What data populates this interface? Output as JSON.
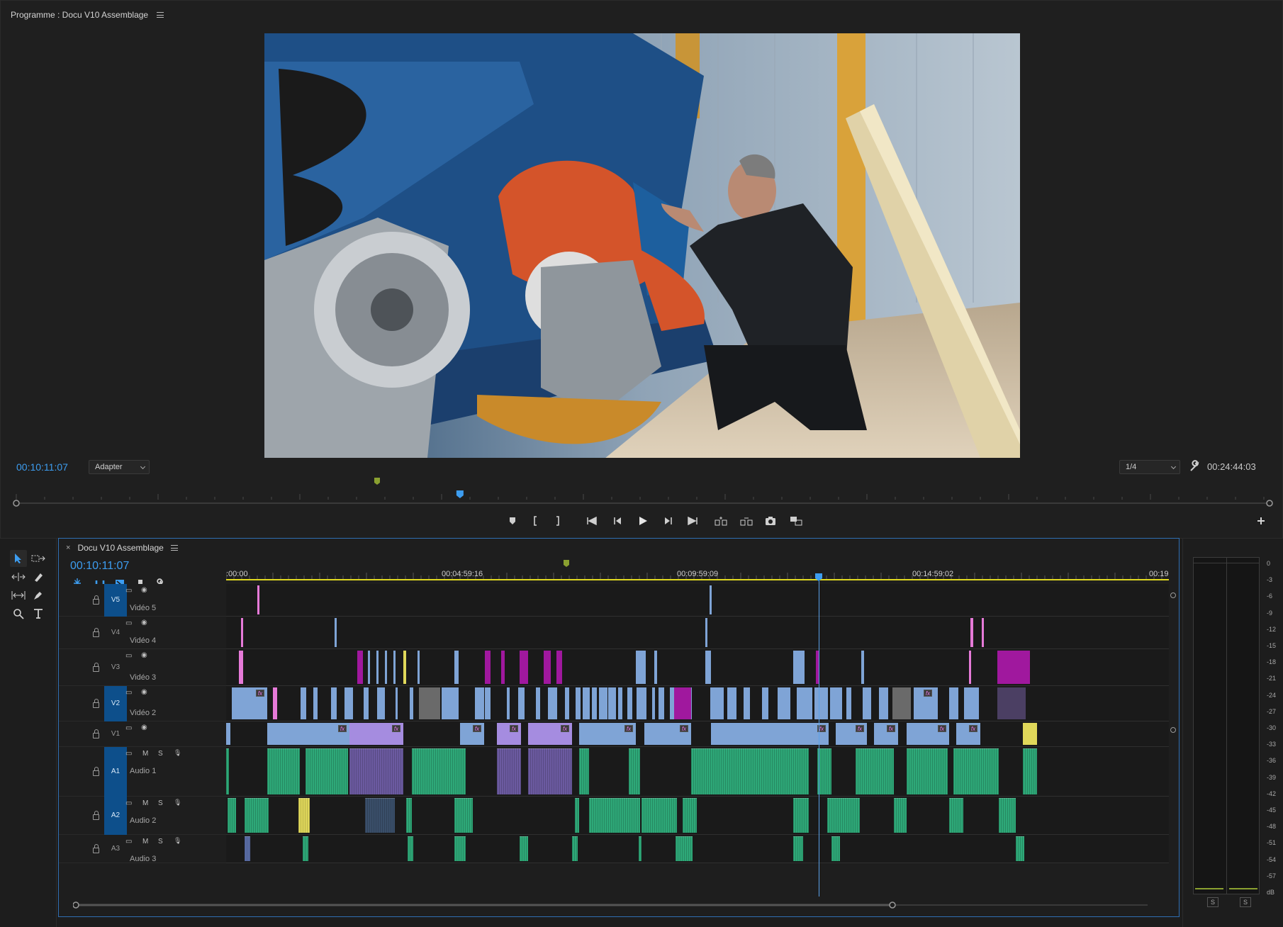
{
  "program": {
    "title": "Programme : Docu V10 Assemblage",
    "current_timecode": "00:10:11:07",
    "fit_label": "Adapter",
    "resolution_label": "1/4",
    "duration_timecode": "00:24:44:03",
    "playhead_fraction": 0.354
  },
  "timeline": {
    "sequence_name": "Docu V10 Assemblage",
    "current_timecode": "00:10:11:07",
    "ruler_labels": [
      ":00:00",
      "00:04:59:16",
      "00:09:59:09",
      "00:14:59:02",
      "00:19"
    ],
    "tracks": [
      {
        "id": "V5",
        "name": "Vidéo 5",
        "kind": "video",
        "targeted": true
      },
      {
        "id": "V4",
        "name": "Vidéo 4",
        "kind": "video",
        "targeted": false
      },
      {
        "id": "V3",
        "name": "Vidéo 3",
        "kind": "video",
        "targeted": false
      },
      {
        "id": "V2",
        "name": "Vidéo 2",
        "kind": "video",
        "targeted": true
      },
      {
        "id": "V1",
        "name": "",
        "kind": "video",
        "targeted": false
      },
      {
        "id": "A1",
        "name": "Audio 1",
        "kind": "audio",
        "targeted": true
      },
      {
        "id": "A2",
        "name": "Audio 2",
        "kind": "audio",
        "targeted": true
      },
      {
        "id": "A3",
        "name": "Audio 3",
        "kind": "audio",
        "targeted": false
      }
    ],
    "track_buttons": {
      "mute": "M",
      "solo": "S"
    }
  },
  "meter": {
    "db_labels": [
      "0",
      "-3",
      "-6",
      "-9",
      "-12",
      "-15",
      "-18",
      "-21",
      "-24",
      "-27",
      "-30",
      "-33",
      "-36",
      "-39",
      "-42",
      "-45",
      "-48",
      "-51",
      "-54",
      "-57",
      "dB"
    ],
    "solo_left": "S",
    "solo_right": "S"
  },
  "colors": {
    "accent": "#3d9df0",
    "video_clip": "#7fa4d6",
    "purple_clip": "#a58ce0",
    "magenta_clip": "#a0189e",
    "pink_clip": "#e67ad8",
    "yellow_clip": "#e0d85a",
    "audio_clip": "#2ea878"
  },
  "icons": {
    "selection": "arrow-icon",
    "track_select": "track-select-icon",
    "razor": "razor-icon",
    "ripple": "ripple-edit-icon",
    "pen": "pen-icon",
    "zoom": "zoom-icon",
    "type": "type-icon"
  }
}
